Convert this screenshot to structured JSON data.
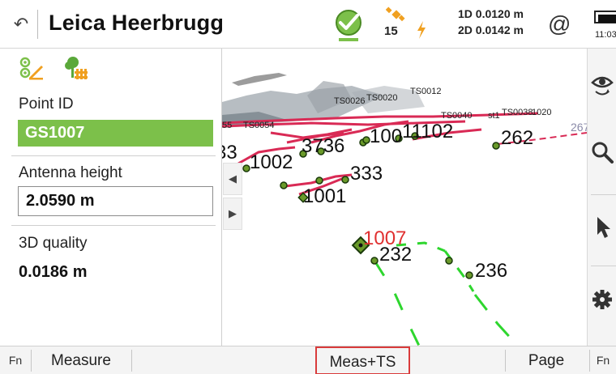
{
  "titlebar": {
    "title": "Leica Heerbrugg",
    "satellites": "15",
    "precision_1d": "1D 0.0120 m",
    "precision_2d": "2D 0.0142 m",
    "at_symbol": "@",
    "time": "11:03",
    "icons": [
      "back-icon",
      "position-status-check-icon",
      "satellite-icon",
      "lightning-icon",
      "battery-icon"
    ]
  },
  "leftpanel": {
    "icons": [
      "point-pencil-icon",
      "tree-fence-icon"
    ],
    "point_id_label": "Point ID",
    "point_id_value": "GS1007",
    "antenna_label": "Antenna height",
    "antenna_value": "2.0590 m",
    "quality_label": "3D quality",
    "quality_value": "0.0186 m"
  },
  "map": {
    "points": [
      {
        "label": "1007",
        "color": "#e03030"
      },
      {
        "label": "232"
      },
      {
        "label": "236"
      },
      {
        "label": "1001"
      },
      {
        "label": "333"
      },
      {
        "label": "1002"
      },
      {
        "label": "3736"
      },
      {
        "label": "100"
      },
      {
        "label": "11102"
      },
      {
        "label": "262"
      },
      {
        "label": "33"
      }
    ],
    "small_labels": [
      "TS0012",
      "TS0026",
      "TS0020",
      "TS0054",
      "TS0038",
      "1020",
      "st1",
      "TS0040",
      "55",
      "267"
    ],
    "scroll_left": "◀",
    "scroll_right": "▶",
    "line_color_red": "#d92a55",
    "line_color_green": "#2ed62e"
  },
  "righttools": {
    "icons": [
      "eye-refresh-icon",
      "zoom-icon",
      "pointer-arrow-icon",
      "gear-icon"
    ]
  },
  "bottombar": {
    "fn_left": "Fn",
    "measure": "Measure",
    "meas_ts": "Meas+TS",
    "page": "Page",
    "fn_right": "Fn"
  }
}
